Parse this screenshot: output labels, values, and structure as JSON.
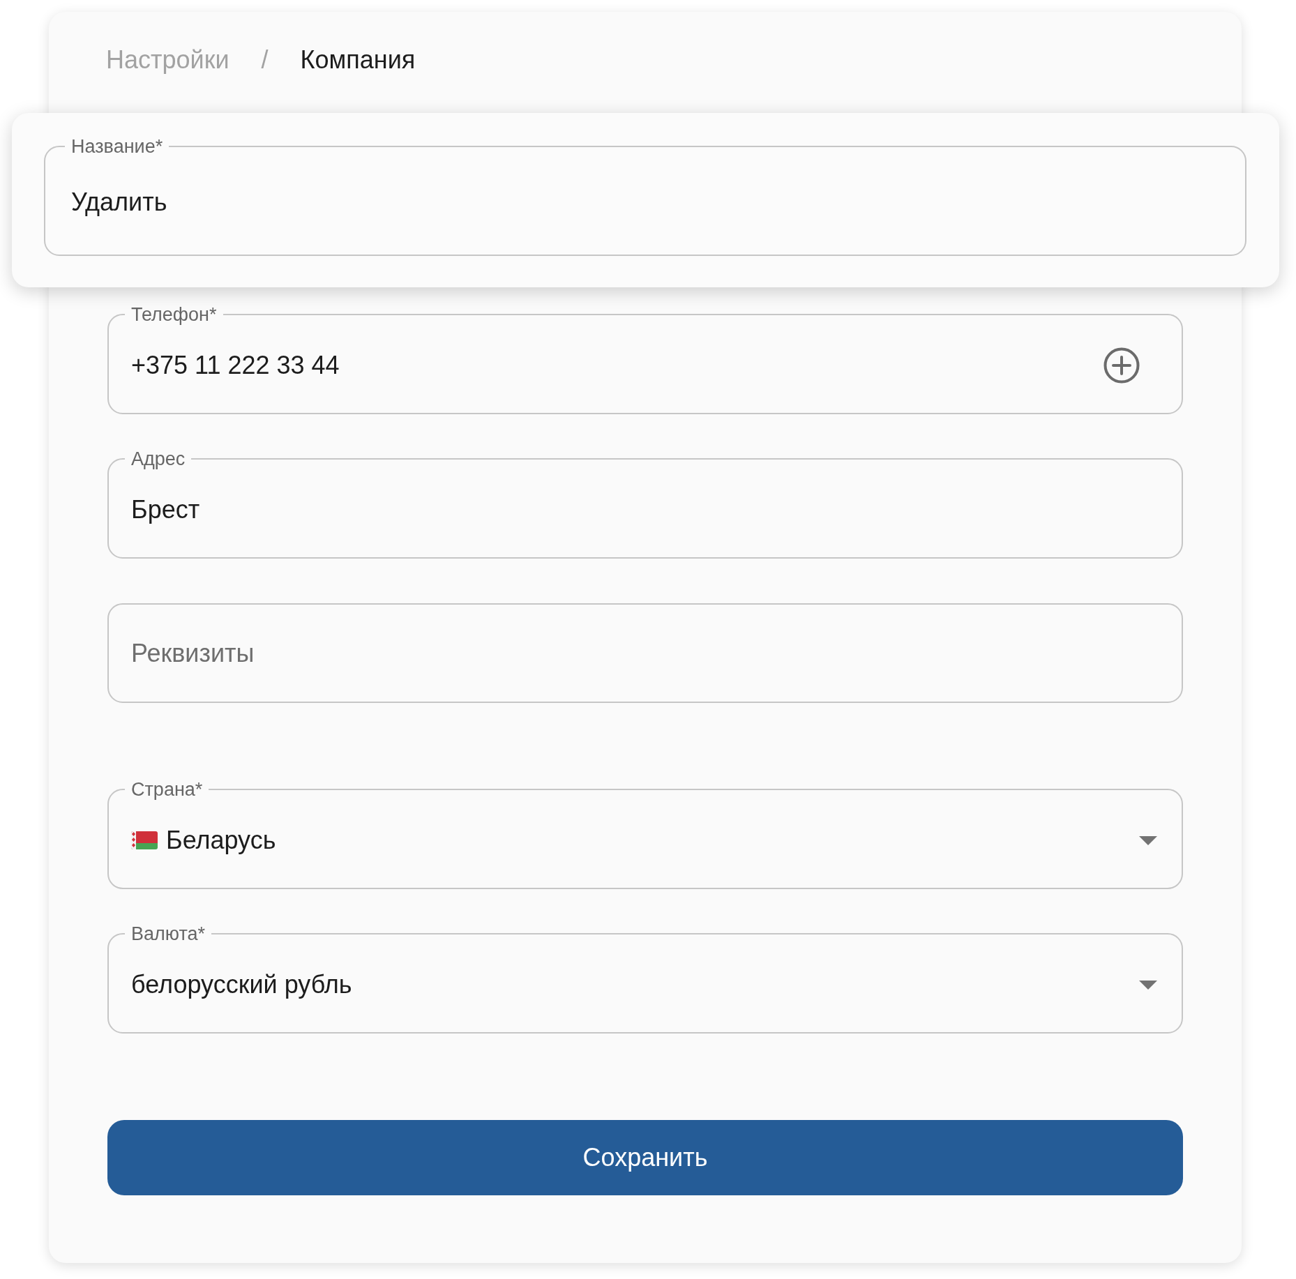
{
  "breadcrumb": {
    "items": [
      {
        "label": "Настройки",
        "current": false
      },
      {
        "label": "Компания",
        "current": true
      }
    ],
    "separator": "/"
  },
  "name_card": {
    "field": {
      "kind": "text",
      "label": "Название*",
      "value": "Удалить"
    }
  },
  "sections": [
    {
      "fields": [
        {
          "kind": "phone",
          "label": "Телефон*",
          "value": "+375 11 222 33 44"
        },
        {
          "kind": "text",
          "label": "Адрес",
          "value": "Брест"
        },
        {
          "kind": "text",
          "placeholder": "Реквизиты"
        }
      ]
    },
    {
      "fields": [
        {
          "kind": "country",
          "label": "Страна*",
          "value": "Беларусь"
        },
        {
          "kind": "select",
          "label": "Валюта*",
          "value": "белорусский рубль"
        }
      ]
    }
  ],
  "save_button": {
    "label": "Сохранить"
  }
}
